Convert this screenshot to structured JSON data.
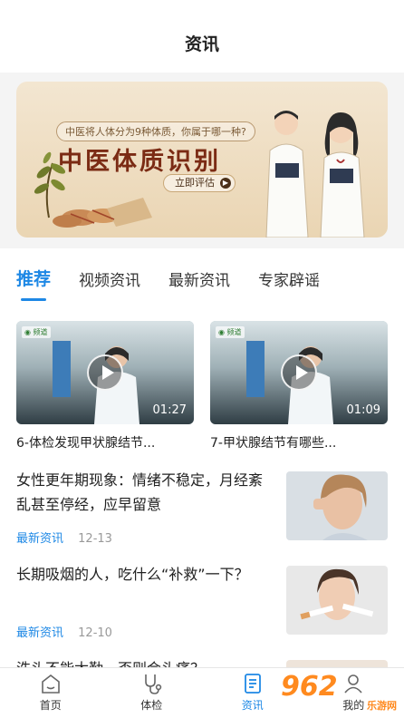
{
  "header": {
    "title": "资讯"
  },
  "banner": {
    "subtitle": "中医将人体分为9种体质，你属于哪一种?",
    "title": "中医体质识别",
    "button_label": "立即评估",
    "button_icon": "chevron-right-icon"
  },
  "tabs": [
    {
      "label": "推荐",
      "active": true
    },
    {
      "label": "视频资讯",
      "active": false
    },
    {
      "label": "最新资讯",
      "active": false
    },
    {
      "label": "专家辟谣",
      "active": false
    }
  ],
  "videos": [
    {
      "duration": "01:27",
      "caption": "6-体检发现甲状腺结节..."
    },
    {
      "duration": "01:09",
      "caption": "7-甲状腺结节有哪些..."
    }
  ],
  "articles": [
    {
      "title": "女性更年期现象：情绪不稳定，月经紊乱甚至停经，应早留意",
      "category": "最新资讯",
      "date": "12-13"
    },
    {
      "title": "长期吸烟的人，吃什么“补救”一下？",
      "category": "最新资讯",
      "date": "12-10"
    },
    {
      "title": "洗头不能太勤，否则会头痛？",
      "category": "",
      "date": ""
    }
  ],
  "tabbar": [
    {
      "label": "首页",
      "icon": "home-icon",
      "active": false
    },
    {
      "label": "体检",
      "icon": "stethoscope-icon",
      "active": false
    },
    {
      "label": "资讯",
      "icon": "news-icon",
      "active": true
    },
    {
      "label": "我的",
      "icon": "user-icon",
      "active": false
    }
  ],
  "watermark": {
    "number": "962",
    "text": "乐游网"
  },
  "colors": {
    "accent": "#1e88e5",
    "banner_title": "#7b2b14",
    "watermark": "#ff8a1f"
  }
}
